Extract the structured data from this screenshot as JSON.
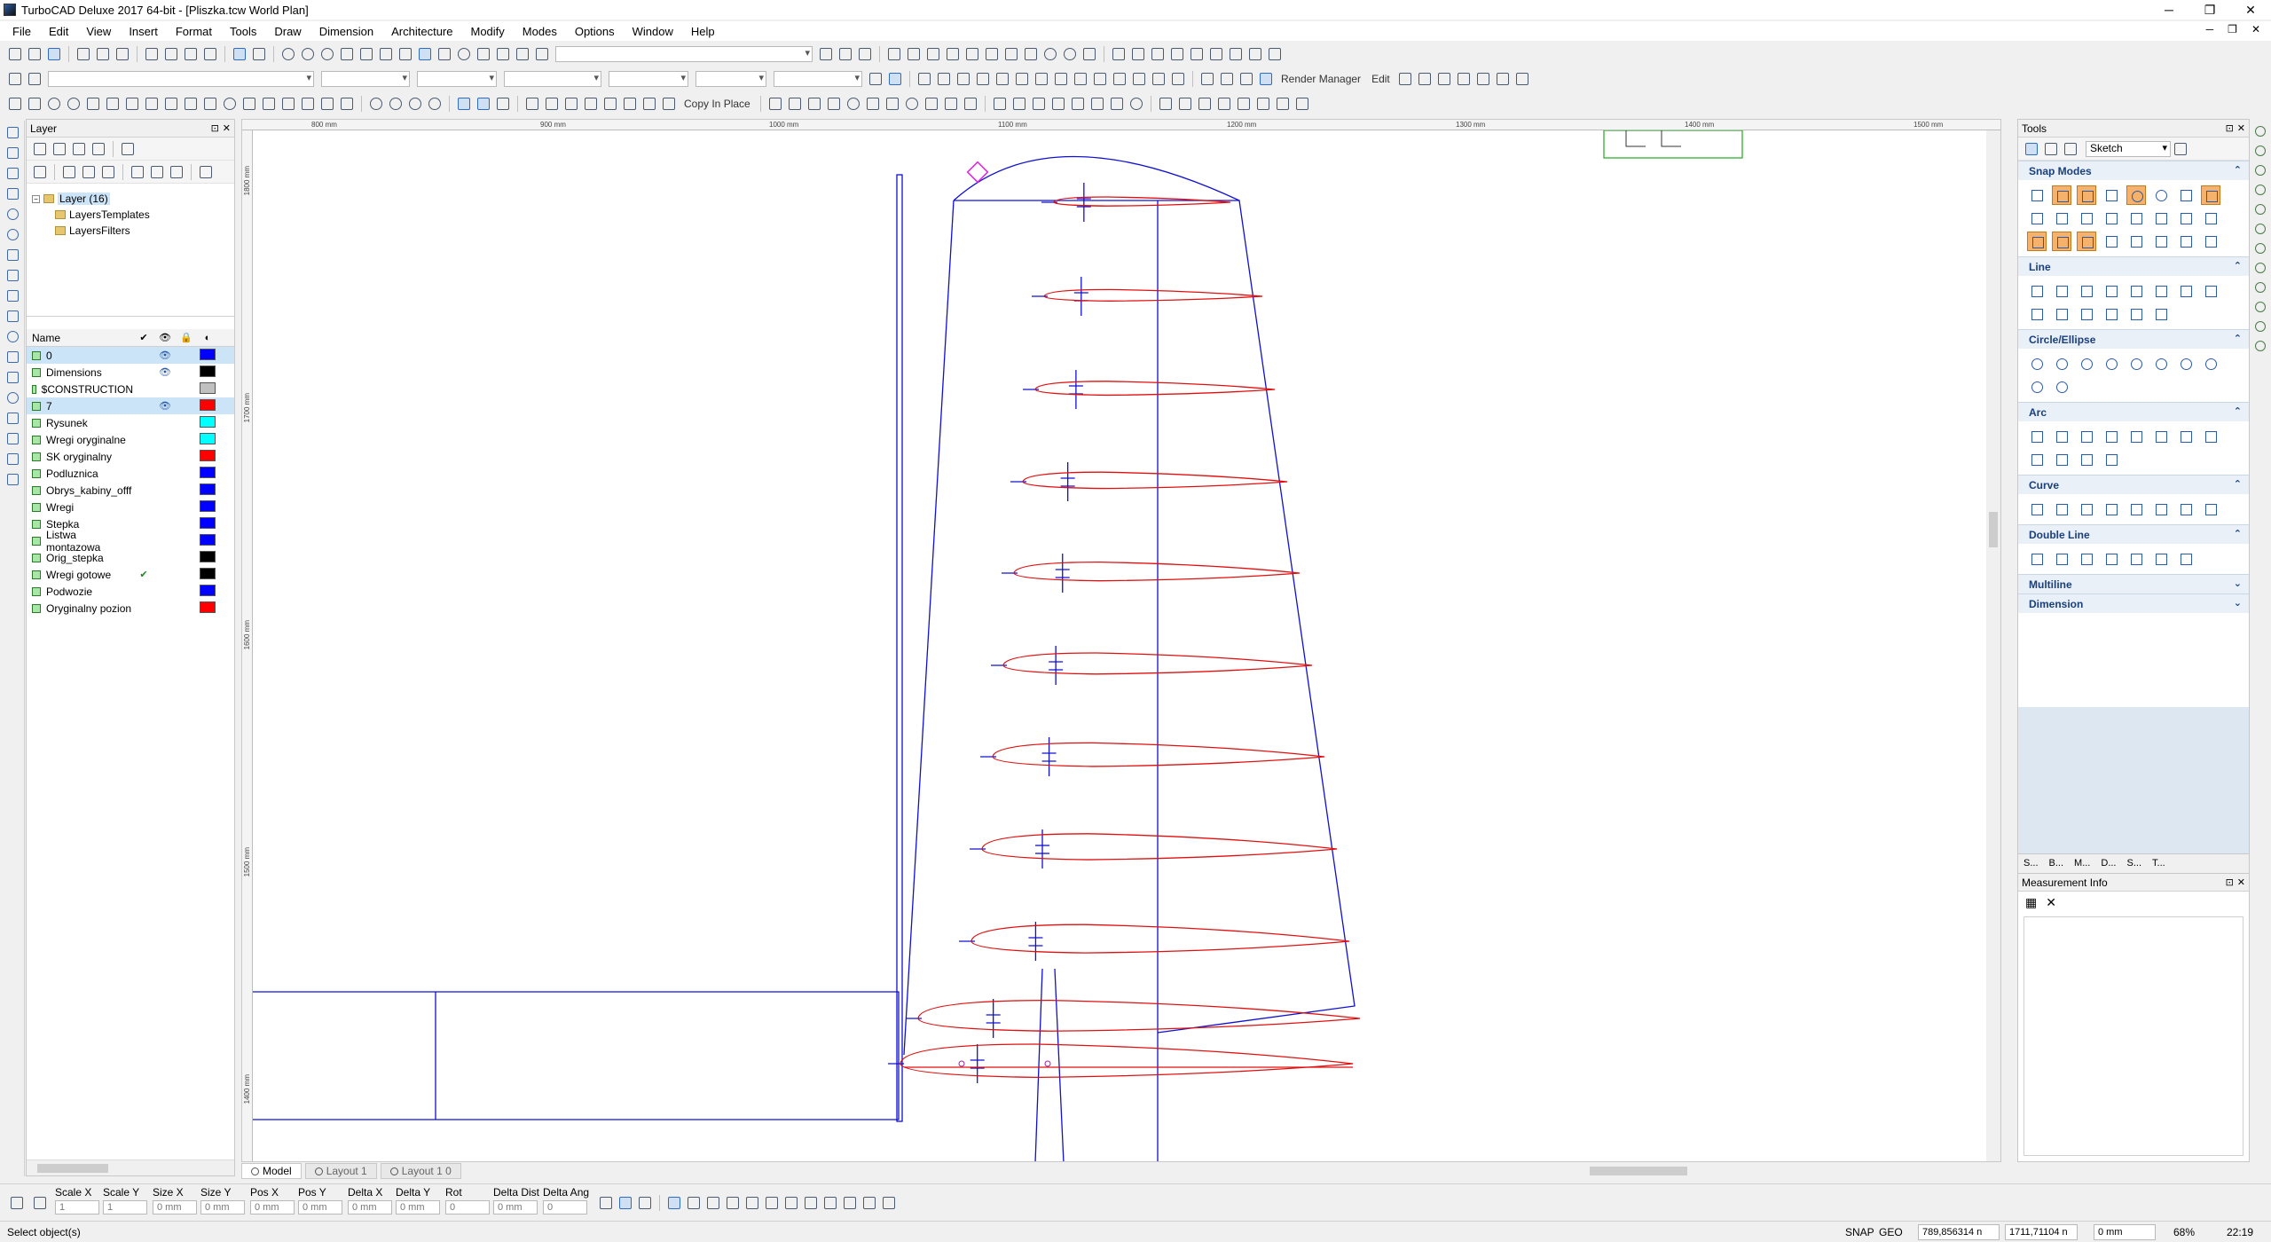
{
  "window": {
    "title": "TurboCAD Deluxe 2017 64-bit - [Pliszka.tcw World Plan]"
  },
  "menu": [
    "File",
    "Edit",
    "View",
    "Insert",
    "Format",
    "Tools",
    "Draw",
    "Dimension",
    "Architecture",
    "Modify",
    "Modes",
    "Options",
    "Window",
    "Help"
  ],
  "toolbar": {
    "copy_in_place": "Copy In Place",
    "render_manager": "Render Manager",
    "edit": "Edit"
  },
  "layer_panel": {
    "title": "Layer",
    "tree": [
      {
        "label": "Layer (16)"
      },
      {
        "label": "LayersTemplates"
      },
      {
        "label": "LayersFilters"
      }
    ],
    "grid_header": {
      "name": "Name"
    },
    "layers": [
      {
        "name": "0",
        "visible": true,
        "color": "#0000ff",
        "selected": true
      },
      {
        "name": "Dimensions",
        "visible": true,
        "color": "#000000"
      },
      {
        "name": "$CONSTRUCTION",
        "visible": false,
        "color": "#c0c0c0"
      },
      {
        "name": "7",
        "visible": true,
        "color": "#ff0000",
        "selected": true
      },
      {
        "name": "Rysunek",
        "visible": false,
        "color": "#00ffff"
      },
      {
        "name": "Wregi oryginalne",
        "visible": false,
        "color": "#00ffff"
      },
      {
        "name": "SK oryginalny",
        "visible": false,
        "color": "#ff0000"
      },
      {
        "name": "Podluznica",
        "visible": false,
        "color": "#0000ff"
      },
      {
        "name": "Obrys_kabiny_offf",
        "visible": false,
        "color": "#0000ff"
      },
      {
        "name": "Wregi",
        "visible": false,
        "color": "#0000ff"
      },
      {
        "name": "Stepka",
        "visible": false,
        "color": "#0000ff"
      },
      {
        "name": "Listwa montazowa",
        "visible": false,
        "color": "#0000ff"
      },
      {
        "name": "Orig_stepka",
        "visible": false,
        "color": "#000000"
      },
      {
        "name": "Wregi gotowe",
        "visible": false,
        "color": "#000000",
        "current": true
      },
      {
        "name": "Podwozie",
        "visible": false,
        "color": "#0000ff"
      },
      {
        "name": "Oryginalny pozion",
        "visible": false,
        "color": "#ff0000"
      }
    ]
  },
  "rulers": {
    "top": [
      "800 mm",
      "900 mm",
      "1000 mm",
      "1100 mm",
      "1200 mm",
      "1300 mm",
      "1400 mm",
      "1500 mm"
    ],
    "left": [
      "1800 mm",
      "1700 mm",
      "1600 mm",
      "1500 mm",
      "1400 mm"
    ]
  },
  "tabs": [
    "Model",
    "Layout 1",
    "Layout 1 0"
  ],
  "tools_panel": {
    "title": "Tools",
    "mode": "Sketch",
    "sections": [
      {
        "title": "Snap Modes",
        "expanded": true
      },
      {
        "title": "Line",
        "expanded": true
      },
      {
        "title": "Circle/Ellipse",
        "expanded": true
      },
      {
        "title": "Arc",
        "expanded": true
      },
      {
        "title": "Curve",
        "expanded": true
      },
      {
        "title": "Double Line",
        "expanded": true
      },
      {
        "title": "Multiline",
        "expanded": false
      },
      {
        "title": "Dimension",
        "expanded": false
      }
    ],
    "bottom_tabs": [
      "S...",
      "B...",
      "M...",
      "D...",
      "S...",
      "T..."
    ]
  },
  "measurement_panel": {
    "title": "Measurement Info"
  },
  "properties": {
    "labels": [
      "Scale X",
      "Scale Y",
      "Size X",
      "Size Y",
      "Pos X",
      "Pos Y",
      "Delta X",
      "Delta Y",
      "Rot",
      "Delta Dist",
      "Delta Ang"
    ],
    "values": [
      "1",
      "1",
      "0 mm",
      "0 mm",
      "0 mm",
      "0 mm",
      "0 mm",
      "0 mm",
      "0",
      "0 mm",
      "0"
    ]
  },
  "status": {
    "message": "Select object(s)",
    "snap": "SNAP",
    "geo": "GEO",
    "coord_x": "789,856314 n",
    "coord_y": "1711,71104 n",
    "coord_z": "0 mm",
    "zoom": "68%",
    "time": "22:19"
  },
  "colors": {
    "wing_outline": "#1010d0",
    "rib": "#e01010",
    "accent": "#f6b26b"
  }
}
